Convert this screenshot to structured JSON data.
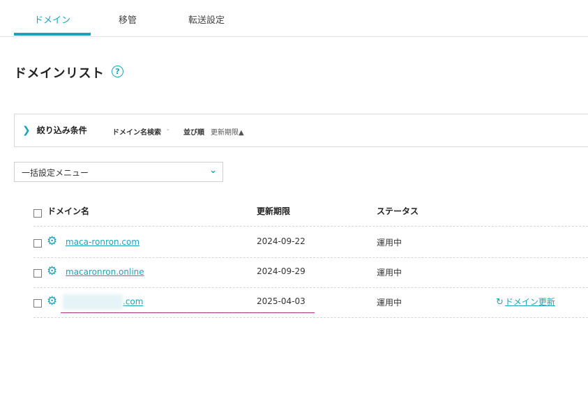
{
  "tabs": [
    {
      "label": "ドメイン",
      "active": true
    },
    {
      "label": "移管",
      "active": false
    },
    {
      "label": "転送設定",
      "active": false
    }
  ],
  "page": {
    "title": "ドメインリスト",
    "help_icon": "?"
  },
  "filter": {
    "toggle_icon": "❯",
    "label": "絞り込み条件",
    "search_label": "ドメイン名検索",
    "search_value": "-",
    "sort_label": "並び順",
    "sort_value": "更新期限▲"
  },
  "bulk_menu": {
    "label": "一括設定メニュー",
    "chevron": "⌄"
  },
  "table": {
    "headers": {
      "domain": "ドメイン名",
      "expiry": "更新期限",
      "status": "ステータス"
    },
    "rows": [
      {
        "domain": "maca-ronron.com",
        "expiry": "2024-09-22",
        "status": "運用中"
      },
      {
        "domain": "macaronron.online",
        "expiry": "2024-09-29",
        "status": "運用中"
      },
      {
        "domain": ".com",
        "expiry": "2025-04-03",
        "status": "運用中",
        "action": "ドメイン更新"
      }
    ]
  },
  "icons": {
    "gear": "⚙",
    "renew": "↻"
  },
  "colors": {
    "accent": "#1ba3bb",
    "annotation": "#b0307e"
  }
}
